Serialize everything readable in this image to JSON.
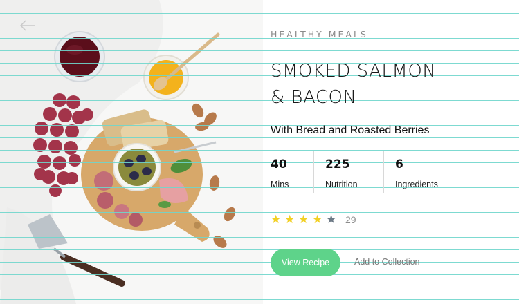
{
  "nav": {
    "back_icon": "arrow-left-icon"
  },
  "recipe": {
    "category": "HEALTHY MEALS",
    "title_line1": "SMOKED SALMON",
    "title_line2": "& BACON",
    "subtitle": "With Bread and Roasted Berries"
  },
  "stats": [
    {
      "value": "40",
      "label": "Mins"
    },
    {
      "value": "225",
      "label": "Nutrition"
    },
    {
      "value": "6",
      "label": "Ingredients"
    }
  ],
  "rating": {
    "stars_filled": 4,
    "stars_total": 5,
    "count": "29",
    "icon": "star-icon"
  },
  "actions": {
    "view_label": "View Recipe",
    "collection_label": "Add to Collection"
  },
  "colors": {
    "accent": "#5ed38a",
    "star": "#f2d024",
    "rules": "#6fd6cc"
  }
}
